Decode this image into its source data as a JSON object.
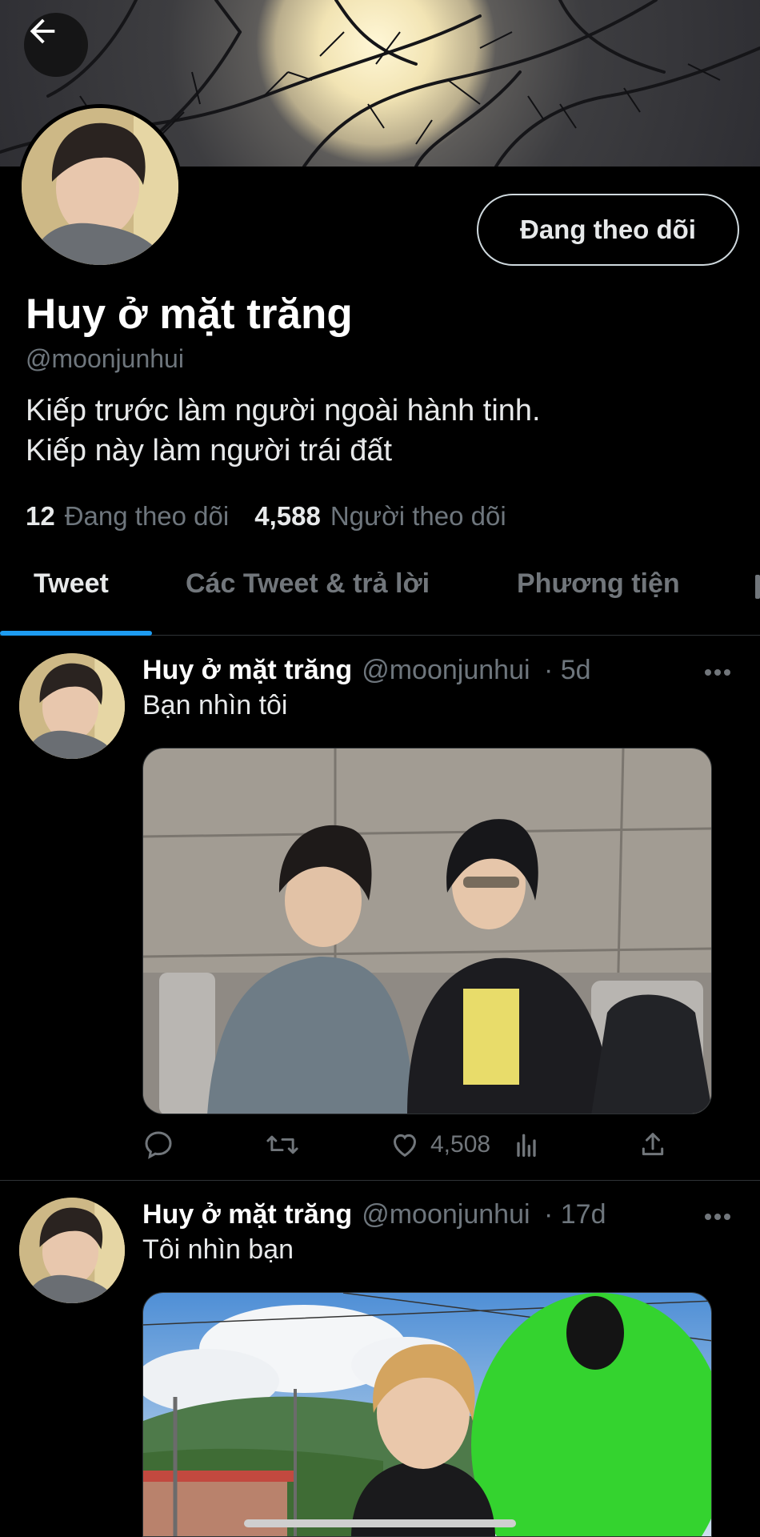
{
  "profile": {
    "display_name": "Huy ở mặt trăng",
    "handle": "@moonjunhui",
    "bio_line1": "Kiếp trước làm người ngoài hành tinh.",
    "bio_line2": "Kiếp này làm người trái đất",
    "following_count": "12",
    "following_label": "Đang theo dõi",
    "followers_count": "4,588",
    "followers_label": "Người theo dõi",
    "follow_button_label": "Đang theo dõi"
  },
  "tabs": [
    {
      "label": "Tweet",
      "active": true
    },
    {
      "label": "Các Tweet & trả lời",
      "active": false
    },
    {
      "label": "Phương tiện",
      "active": false
    }
  ],
  "tweets": [
    {
      "author": "Huy ở mặt trăng",
      "handle": "@moonjunhui",
      "time": "· 5d",
      "text": "Bạn nhìn tôi",
      "likes": "4,508"
    },
    {
      "author": "Huy ở mặt trăng",
      "handle": "@moonjunhui",
      "time": "· 17d",
      "text": "Tôi nhìn bạn"
    }
  ],
  "icons": {
    "back": "arrow-left-icon",
    "more": "more-horizontal-icon",
    "reply": "reply-icon",
    "retweet": "retweet-icon",
    "like": "heart-icon",
    "views": "analytics-icon",
    "share": "share-icon"
  },
  "colors": {
    "accent": "#1d9bf0",
    "background": "#000000",
    "muted_text": "#6e767d"
  }
}
